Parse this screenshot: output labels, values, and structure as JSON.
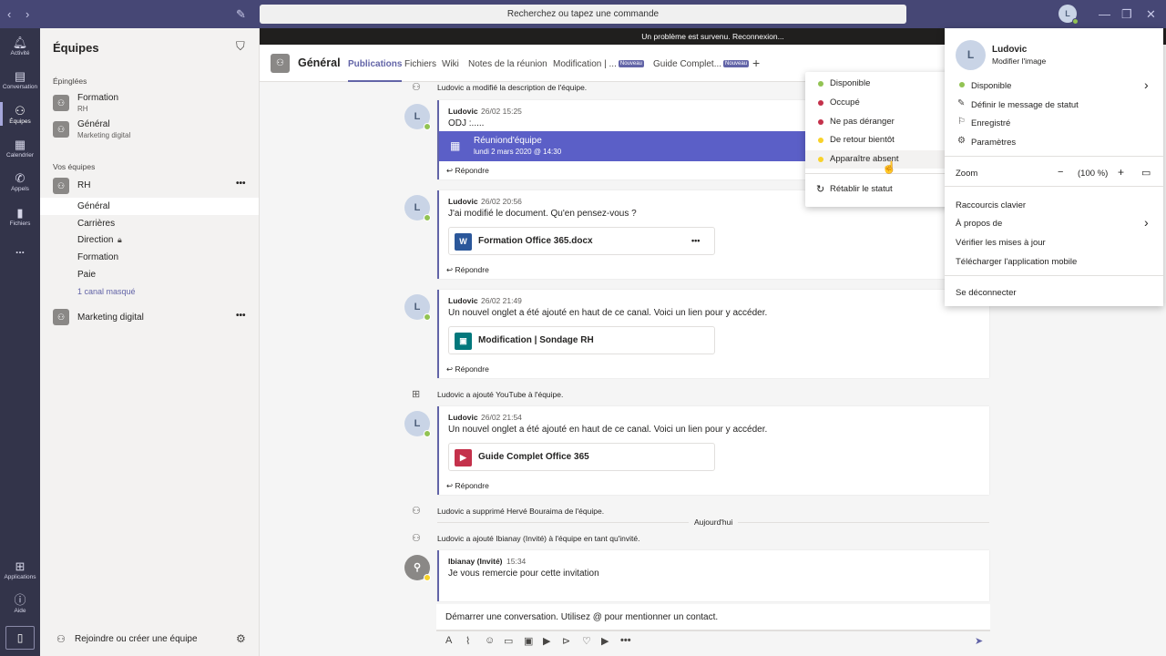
{
  "titlebar": {
    "search_placeholder": "Recherchez ou tapez une commande",
    "avatar_initial": "L"
  },
  "rail": {
    "items": [
      "Activité",
      "Conversation",
      "Équipes",
      "Calendrier",
      "Appels",
      "Fichiers",
      "..."
    ],
    "bottom": [
      "Applications",
      "Aide"
    ]
  },
  "teams": {
    "title": "Équipes",
    "pinned_label": "Épinglées",
    "pinned": [
      {
        "name": "Formation",
        "sub": "RH"
      },
      {
        "name": "Général",
        "sub": "Marketing digital"
      }
    ],
    "your_teams_label": "Vos équipes",
    "team1": "RH",
    "channels": [
      "Général",
      "Carrières",
      "Direction",
      "Formation",
      "Paie",
      "1 canal masqué"
    ],
    "team2": "Marketing digital",
    "join": "Rejoindre ou créer une équipe"
  },
  "error": "Un problème est survenu. Reconnexion...",
  "channel": {
    "name": "Général",
    "tabs": [
      "Publications",
      "Fichiers",
      "Wiki",
      "Notes de la réunion",
      "Modification | ...",
      "Guide Complet..."
    ],
    "new_badge": "Nouveau",
    "add": "+"
  },
  "feed": {
    "sys1": "Ludovic a modifié la description de l'équipe.",
    "post1": {
      "author": "Ludovic",
      "time": "26/02 15:25",
      "text": "ODJ :.....",
      "meeting_title": "Réuniond'équipe",
      "meeting_date": "lundi 2 mars 2020 @ 14:30"
    },
    "post2": {
      "author": "Ludovic",
      "time": "26/02 20:56",
      "text": "J'ai modifié le document. Qu'en pensez-vous ?",
      "file": "Formation Office 365.docx"
    },
    "post3": {
      "author": "Ludovic",
      "time": "26/02 21:49",
      "text": "Un nouvel onglet a été ajouté en haut de ce canal. Voici un lien pour y accéder.",
      "link": "Modification | Sondage RH"
    },
    "sys2": "Ludovic a ajouté YouTube à l'équipe.",
    "post4": {
      "author": "Ludovic",
      "time": "26/02 21:54",
      "text": "Un nouvel onglet a été ajouté en haut de ce canal. Voici un lien pour y accéder.",
      "link": "Guide Complet Office 365"
    },
    "sys3": "Ludovic a supprimé Hervé Bouraima de l'équipe.",
    "today": "Aujourd'hui",
    "sys4": "Ludovic a ajouté Ibianay (Invité) à l'équipe en tant qu'invité.",
    "post5": {
      "author": "Ibianay (Invité)",
      "time": "15:34",
      "text": "Je vous remercie pour cette invitation"
    },
    "reply": "Répondre",
    "avatar": "L",
    "file_ic": "W",
    "more": "•••"
  },
  "compose": {
    "placeholder": "Démarrer une conversation. Utilisez @ pour mentionner un contact."
  },
  "status_menu": {
    "items": [
      "Disponible",
      "Occupé",
      "Ne pas déranger",
      "De retour bientôt",
      "Apparaître absent"
    ],
    "colors": [
      "#92c353",
      "#c4314b",
      "#c4314b",
      "#f8d22a",
      "#f8d22a"
    ],
    "reset": "Rétablir le statut"
  },
  "profile": {
    "name": "Ludovic",
    "change_image": "Modifier l'image",
    "initial": "L",
    "status": "Disponible",
    "status_msg": "Définir le message de statut",
    "saved": "Enregistré",
    "settings": "Paramètres",
    "zoom_label": "Zoom",
    "zoom_value": "(100 %)",
    "zoom_minus": "−",
    "zoom_plus": "+",
    "shortcuts": "Raccourcis clavier",
    "about": "À propos de",
    "updates": "Vérifier les mises à jour",
    "mobile": "Télécharger l'application mobile",
    "signout": "Se déconnecter"
  }
}
